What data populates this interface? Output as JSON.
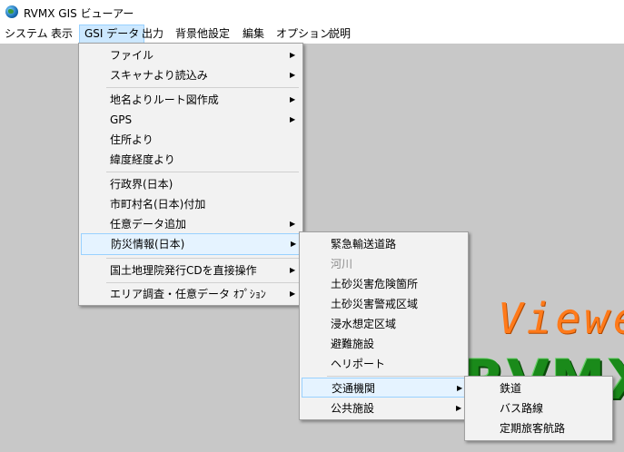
{
  "window": {
    "title": "RVMX GIS ビューアー"
  },
  "menubar": {
    "items": [
      {
        "label": "システム"
      },
      {
        "label": "表示"
      },
      {
        "label": "GSI データ"
      },
      {
        "label": "出力"
      },
      {
        "label": "背景他設定"
      },
      {
        "label": "編集"
      },
      {
        "label": "オプション"
      },
      {
        "label": "説明"
      }
    ]
  },
  "gsi_menu": {
    "items": [
      {
        "label": "ファイル",
        "submenu": true
      },
      {
        "label": "スキャナより読込み",
        "submenu": true
      },
      {
        "label": "地名よりルート図作成",
        "submenu": true
      },
      {
        "label": "GPS",
        "submenu": true
      },
      {
        "label": "住所より",
        "submenu": false
      },
      {
        "label": "緯度経度より",
        "submenu": false
      },
      {
        "label": "行政界(日本)",
        "submenu": false
      },
      {
        "label": "市町村名(日本)付加",
        "submenu": false
      },
      {
        "label": "任意データ追加",
        "submenu": true
      },
      {
        "label": "防災情報(日本)",
        "submenu": true
      },
      {
        "label": "国土地理院発行CDを直接操作",
        "submenu": true
      },
      {
        "label": "エリア調査・任意データ ｵﾌﾟｼｮﾝ",
        "submenu": true
      }
    ]
  },
  "bousai_menu": {
    "items": [
      {
        "label": "緊急輸送道路",
        "enabled": true
      },
      {
        "label": "河川",
        "enabled": false
      },
      {
        "label": "土砂災害危険箇所",
        "enabled": true
      },
      {
        "label": "土砂災害警戒区域",
        "enabled": true
      },
      {
        "label": "浸水想定区域",
        "enabled": true
      },
      {
        "label": "避難施設",
        "enabled": true
      },
      {
        "label": "ヘリポート",
        "enabled": true
      },
      {
        "label": "交通機関",
        "enabled": true
      },
      {
        "label": "公共施設",
        "enabled": true
      }
    ]
  },
  "kotsu_menu": {
    "items": [
      {
        "label": "鉄道"
      },
      {
        "label": "バス路線"
      },
      {
        "label": "定期旅客航路"
      }
    ]
  },
  "background_logo": {
    "viewer_text": "Viewe",
    "rvmx_text": "RVMX"
  },
  "colors": {
    "menu_highlight": "#cce8ff",
    "viewer_orange": "#ff7a1a",
    "rvmx_green": "#1a8a1a",
    "client_bg": "#c8c8c8"
  }
}
